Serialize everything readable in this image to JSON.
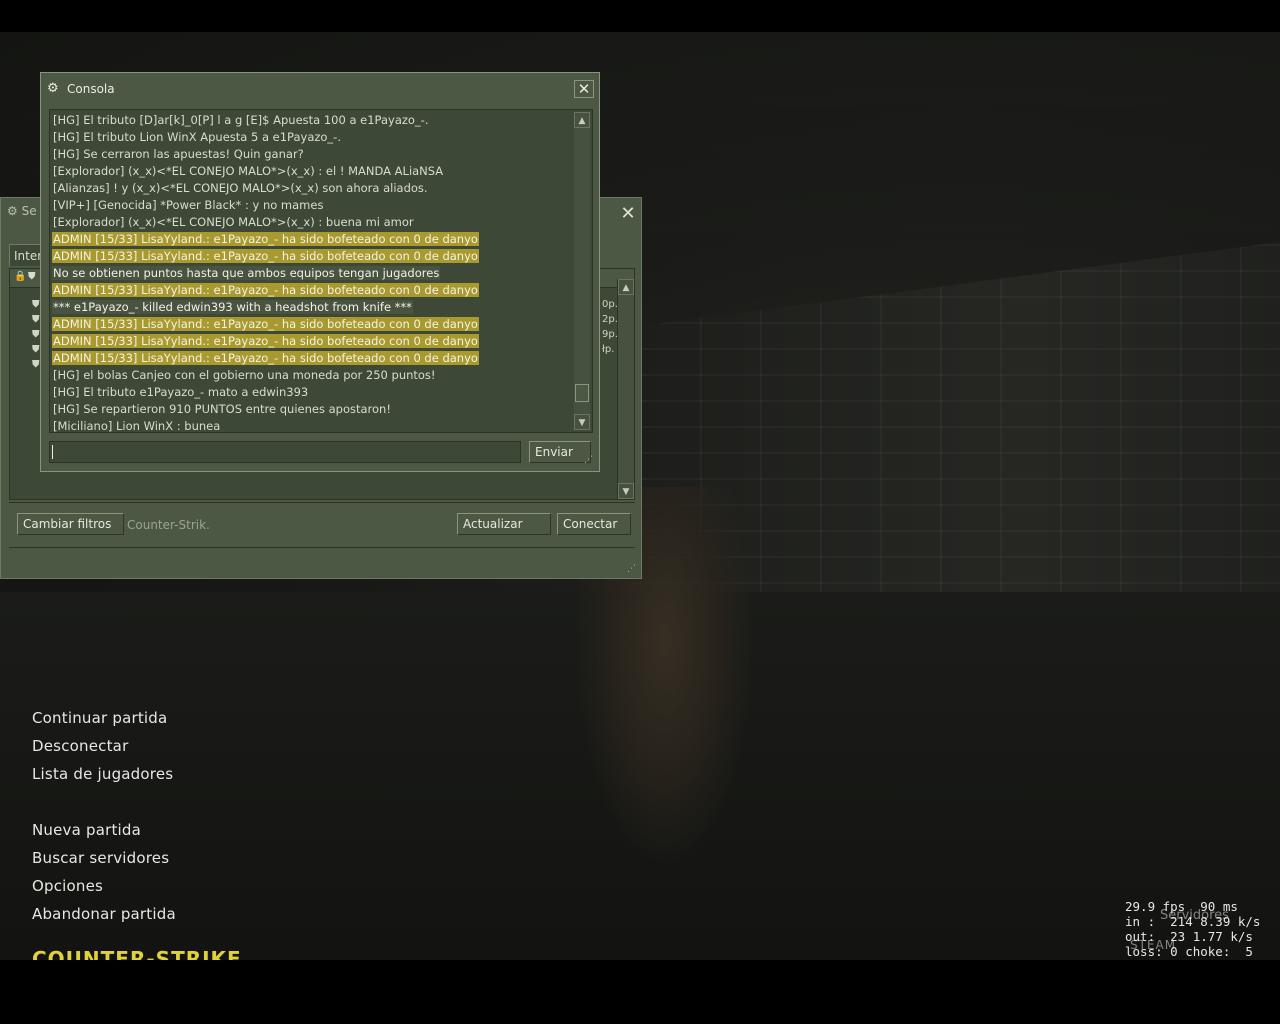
{
  "server_browser": {
    "title": "Se",
    "tab_label": "Inter",
    "pings": [
      "0p.",
      "2p.",
      "9p.",
      "łp."
    ],
    "change_filters_label": "Cambiar filtros",
    "filter_text": "Counter-Strik.",
    "refresh_label": "Actualizar",
    "connect_label": "Conectar"
  },
  "console": {
    "title": "Consola",
    "lines": [
      {
        "text": "[HG] El tributo [D]ar[k]_0[P] l a g [E]$ Apuesta 100 a e1Payazo_-.",
        "style": "normal"
      },
      {
        "text": "[HG] El tributo Lion WinX Apuesta 5 a e1Payazo_-.",
        "style": "normal"
      },
      {
        "text": "[HG] Se cerraron las apuestas! Quin ganar?",
        "style": "normal"
      },
      {
        "text": "[Explorador] (x_x)<*EL CONEJO MALO*>(x_x) :  el ! MANDA ALiaNSA",
        "style": "normal"
      },
      {
        "text": "[Alianzas] ! y (x_x)<*EL CONEJO MALO*>(x_x) son ahora aliados.",
        "style": "normal"
      },
      {
        "text": "[VIP+] [Genocida] *Power Black* :  y no mames",
        "style": "normal"
      },
      {
        "text": "[Explorador] (x_x)<*EL CONEJO MALO*>(x_x) :  buena mi amor",
        "style": "normal"
      },
      {
        "text": "ADMIN [15/33] LisaYyland.: e1Payazo_- ha sido bofeteado con 0 de danyo",
        "style": "highlight"
      },
      {
        "text": "ADMIN [15/33] LisaYyland.: e1Payazo_- ha sido bofeteado con 0 de danyo",
        "style": "highlight"
      },
      {
        "text": "No se obtienen puntos hasta que ambos equipos tengan jugadores",
        "style": "highlight2"
      },
      {
        "text": "ADMIN [15/33] LisaYyland.: e1Payazo_- ha sido bofeteado con 0 de danyo",
        "style": "highlight"
      },
      {
        "text": "*** e1Payazo_- killed edwin393 with a headshot from knife ***",
        "style": "highlight2"
      },
      {
        "text": "ADMIN [15/33] LisaYyland.: e1Payazo_- ha sido bofeteado con 0 de danyo",
        "style": "highlight"
      },
      {
        "text": "ADMIN [15/33] LisaYyland.: e1Payazo_- ha sido bofeteado con 0 de danyo",
        "style": "highlight"
      },
      {
        "text": "ADMIN [15/33] LisaYyland.: e1Payazo_- ha sido bofeteado con 0 de danyo",
        "style": "highlight"
      },
      {
        "text": "[HG] el bolas Canjeo con el gobierno una moneda por 250 puntos!",
        "style": "normal"
      },
      {
        "text": "[HG] El tributo e1Payazo_- mato a edwin393",
        "style": "normal"
      },
      {
        "text": "[HG] Se repartieron 910 PUNTOS entre quienes apostaron!",
        "style": "normal"
      },
      {
        "text": "[Miciliano] Lion WinX :  bunea",
        "style": "normal"
      }
    ],
    "input_value": "",
    "send_label": "Enviar"
  },
  "main_menu": {
    "group1": [
      "Continuar partida",
      "Desconectar",
      "Lista de jugadores"
    ],
    "group2": [
      "Nueva partida",
      "Buscar servidores",
      "Opciones",
      "Abandonar partida"
    ]
  },
  "logo_text": "COUNTER-STRIKE",
  "netgraph": {
    "line1": "29.9 fps  90 ms",
    "line2": "in :  214 8.39 k/s",
    "line3": "out:  23 1.77 k/s",
    "line4": "loss: 0 choke:  5"
  },
  "overlay": {
    "servers_label": "Servidores",
    "steam_label": "STEAM"
  },
  "colors": {
    "panel": "#4c5844",
    "panel_dark": "#3e4837",
    "highlight": "#a89a2e",
    "logo": "#e0d23a"
  }
}
